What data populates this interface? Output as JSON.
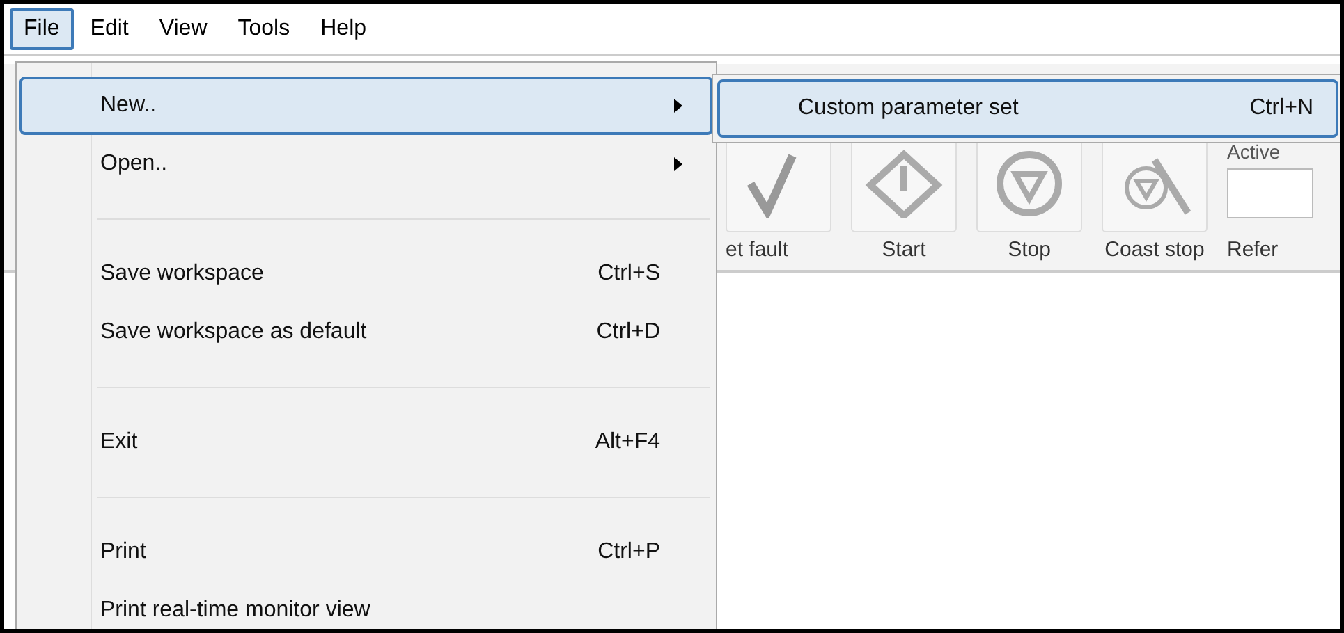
{
  "menu_bar": [
    {
      "label": "File",
      "selected": true
    },
    {
      "label": "Edit",
      "selected": false
    },
    {
      "label": "View",
      "selected": false
    },
    {
      "label": "Tools",
      "selected": false
    },
    {
      "label": "Help",
      "selected": false
    }
  ],
  "toolbar": {
    "buttons": [
      {
        "label": "et fault",
        "kind": "reset"
      },
      {
        "label": "Start",
        "kind": "start"
      },
      {
        "label": "Stop",
        "kind": "stop"
      },
      {
        "label": "Coast stop",
        "kind": "coast"
      }
    ],
    "active_label": "Active",
    "reference_label": "Refer"
  },
  "file_menu": [
    {
      "kind": "item",
      "label": "New..",
      "submenu": true,
      "selected": true
    },
    {
      "kind": "item",
      "label": "Open..",
      "submenu": true,
      "selected": false
    },
    {
      "kind": "separator"
    },
    {
      "kind": "item",
      "label": "Save workspace",
      "shortcut": "Ctrl+S",
      "selected": false
    },
    {
      "kind": "item",
      "label": "Save workspace as default",
      "shortcut": "Ctrl+D",
      "selected": false
    },
    {
      "kind": "separator"
    },
    {
      "kind": "item",
      "label": "Exit",
      "shortcut": "Alt+F4",
      "selected": false
    },
    {
      "kind": "separator"
    },
    {
      "kind": "item",
      "label": "Print",
      "shortcut": "Ctrl+P",
      "selected": false
    },
    {
      "kind": "item",
      "label": "Print real-time monitor view",
      "selected": false
    }
  ],
  "new_submenu": [
    {
      "label": "Custom parameter set",
      "shortcut": "Ctrl+N",
      "selected": true
    }
  ]
}
